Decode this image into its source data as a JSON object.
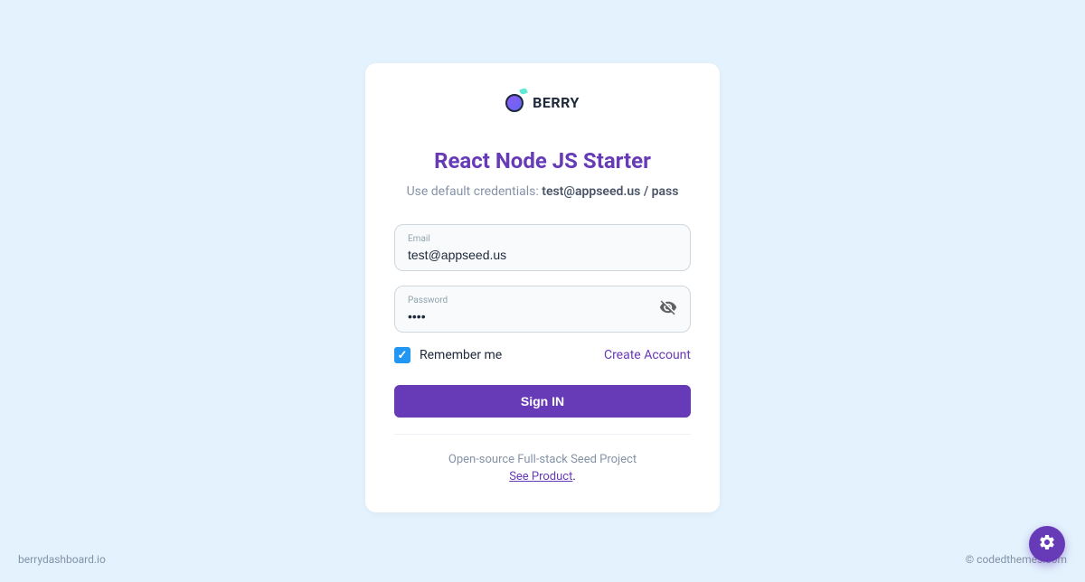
{
  "logo": {
    "name": "BERRY"
  },
  "card": {
    "title": "React Node JS Starter",
    "subtitle_prefix": "Use default credentials: ",
    "subtitle_strong": "test@appseed.us / pass",
    "email": {
      "label": "Email",
      "value": "test@appseed.us"
    },
    "password": {
      "label": "Password",
      "value": "••••"
    },
    "remember_label": "Remember me",
    "remember_checked": true,
    "create_account": "Create Account",
    "signin_label": "Sign IN",
    "footer_text": "Open-source Full-stack Seed Project",
    "footer_link": "See Product",
    "footer_link_suffix": "."
  },
  "page_footer": {
    "left": "berrydashboard.io",
    "right": "© codedthemes.com"
  },
  "colors": {
    "background": "#e3f2fd",
    "primary": "#673ab7",
    "checkbox": "#2196f3"
  }
}
